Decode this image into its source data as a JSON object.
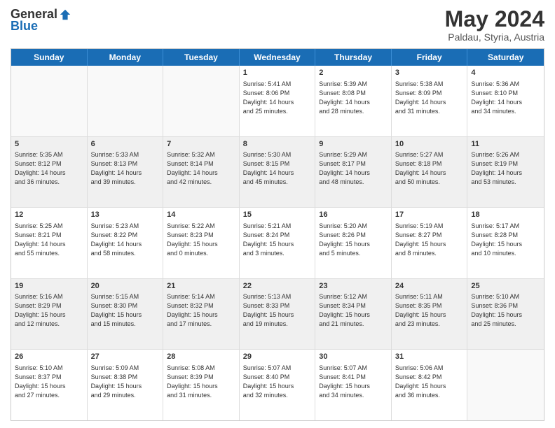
{
  "logo": {
    "general": "General",
    "blue": "Blue"
  },
  "title": "May 2024",
  "subtitle": "Paldau, Styria, Austria",
  "days": [
    "Sunday",
    "Monday",
    "Tuesday",
    "Wednesday",
    "Thursday",
    "Friday",
    "Saturday"
  ],
  "weeks": [
    [
      {
        "day": "",
        "info": ""
      },
      {
        "day": "",
        "info": ""
      },
      {
        "day": "",
        "info": ""
      },
      {
        "day": "1",
        "info": "Sunrise: 5:41 AM\nSunset: 8:06 PM\nDaylight: 14 hours\nand 25 minutes."
      },
      {
        "day": "2",
        "info": "Sunrise: 5:39 AM\nSunset: 8:08 PM\nDaylight: 14 hours\nand 28 minutes."
      },
      {
        "day": "3",
        "info": "Sunrise: 5:38 AM\nSunset: 8:09 PM\nDaylight: 14 hours\nand 31 minutes."
      },
      {
        "day": "4",
        "info": "Sunrise: 5:36 AM\nSunset: 8:10 PM\nDaylight: 14 hours\nand 34 minutes."
      }
    ],
    [
      {
        "day": "5",
        "info": "Sunrise: 5:35 AM\nSunset: 8:12 PM\nDaylight: 14 hours\nand 36 minutes."
      },
      {
        "day": "6",
        "info": "Sunrise: 5:33 AM\nSunset: 8:13 PM\nDaylight: 14 hours\nand 39 minutes."
      },
      {
        "day": "7",
        "info": "Sunrise: 5:32 AM\nSunset: 8:14 PM\nDaylight: 14 hours\nand 42 minutes."
      },
      {
        "day": "8",
        "info": "Sunrise: 5:30 AM\nSunset: 8:15 PM\nDaylight: 14 hours\nand 45 minutes."
      },
      {
        "day": "9",
        "info": "Sunrise: 5:29 AM\nSunset: 8:17 PM\nDaylight: 14 hours\nand 48 minutes."
      },
      {
        "day": "10",
        "info": "Sunrise: 5:27 AM\nSunset: 8:18 PM\nDaylight: 14 hours\nand 50 minutes."
      },
      {
        "day": "11",
        "info": "Sunrise: 5:26 AM\nSunset: 8:19 PM\nDaylight: 14 hours\nand 53 minutes."
      }
    ],
    [
      {
        "day": "12",
        "info": "Sunrise: 5:25 AM\nSunset: 8:21 PM\nDaylight: 14 hours\nand 55 minutes."
      },
      {
        "day": "13",
        "info": "Sunrise: 5:23 AM\nSunset: 8:22 PM\nDaylight: 14 hours\nand 58 minutes."
      },
      {
        "day": "14",
        "info": "Sunrise: 5:22 AM\nSunset: 8:23 PM\nDaylight: 15 hours\nand 0 minutes."
      },
      {
        "day": "15",
        "info": "Sunrise: 5:21 AM\nSunset: 8:24 PM\nDaylight: 15 hours\nand 3 minutes."
      },
      {
        "day": "16",
        "info": "Sunrise: 5:20 AM\nSunset: 8:26 PM\nDaylight: 15 hours\nand 5 minutes."
      },
      {
        "day": "17",
        "info": "Sunrise: 5:19 AM\nSunset: 8:27 PM\nDaylight: 15 hours\nand 8 minutes."
      },
      {
        "day": "18",
        "info": "Sunrise: 5:17 AM\nSunset: 8:28 PM\nDaylight: 15 hours\nand 10 minutes."
      }
    ],
    [
      {
        "day": "19",
        "info": "Sunrise: 5:16 AM\nSunset: 8:29 PM\nDaylight: 15 hours\nand 12 minutes."
      },
      {
        "day": "20",
        "info": "Sunrise: 5:15 AM\nSunset: 8:30 PM\nDaylight: 15 hours\nand 15 minutes."
      },
      {
        "day": "21",
        "info": "Sunrise: 5:14 AM\nSunset: 8:32 PM\nDaylight: 15 hours\nand 17 minutes."
      },
      {
        "day": "22",
        "info": "Sunrise: 5:13 AM\nSunset: 8:33 PM\nDaylight: 15 hours\nand 19 minutes."
      },
      {
        "day": "23",
        "info": "Sunrise: 5:12 AM\nSunset: 8:34 PM\nDaylight: 15 hours\nand 21 minutes."
      },
      {
        "day": "24",
        "info": "Sunrise: 5:11 AM\nSunset: 8:35 PM\nDaylight: 15 hours\nand 23 minutes."
      },
      {
        "day": "25",
        "info": "Sunrise: 5:10 AM\nSunset: 8:36 PM\nDaylight: 15 hours\nand 25 minutes."
      }
    ],
    [
      {
        "day": "26",
        "info": "Sunrise: 5:10 AM\nSunset: 8:37 PM\nDaylight: 15 hours\nand 27 minutes."
      },
      {
        "day": "27",
        "info": "Sunrise: 5:09 AM\nSunset: 8:38 PM\nDaylight: 15 hours\nand 29 minutes."
      },
      {
        "day": "28",
        "info": "Sunrise: 5:08 AM\nSunset: 8:39 PM\nDaylight: 15 hours\nand 31 minutes."
      },
      {
        "day": "29",
        "info": "Sunrise: 5:07 AM\nSunset: 8:40 PM\nDaylight: 15 hours\nand 32 minutes."
      },
      {
        "day": "30",
        "info": "Sunrise: 5:07 AM\nSunset: 8:41 PM\nDaylight: 15 hours\nand 34 minutes."
      },
      {
        "day": "31",
        "info": "Sunrise: 5:06 AM\nSunset: 8:42 PM\nDaylight: 15 hours\nand 36 minutes."
      },
      {
        "day": "",
        "info": ""
      }
    ]
  ]
}
